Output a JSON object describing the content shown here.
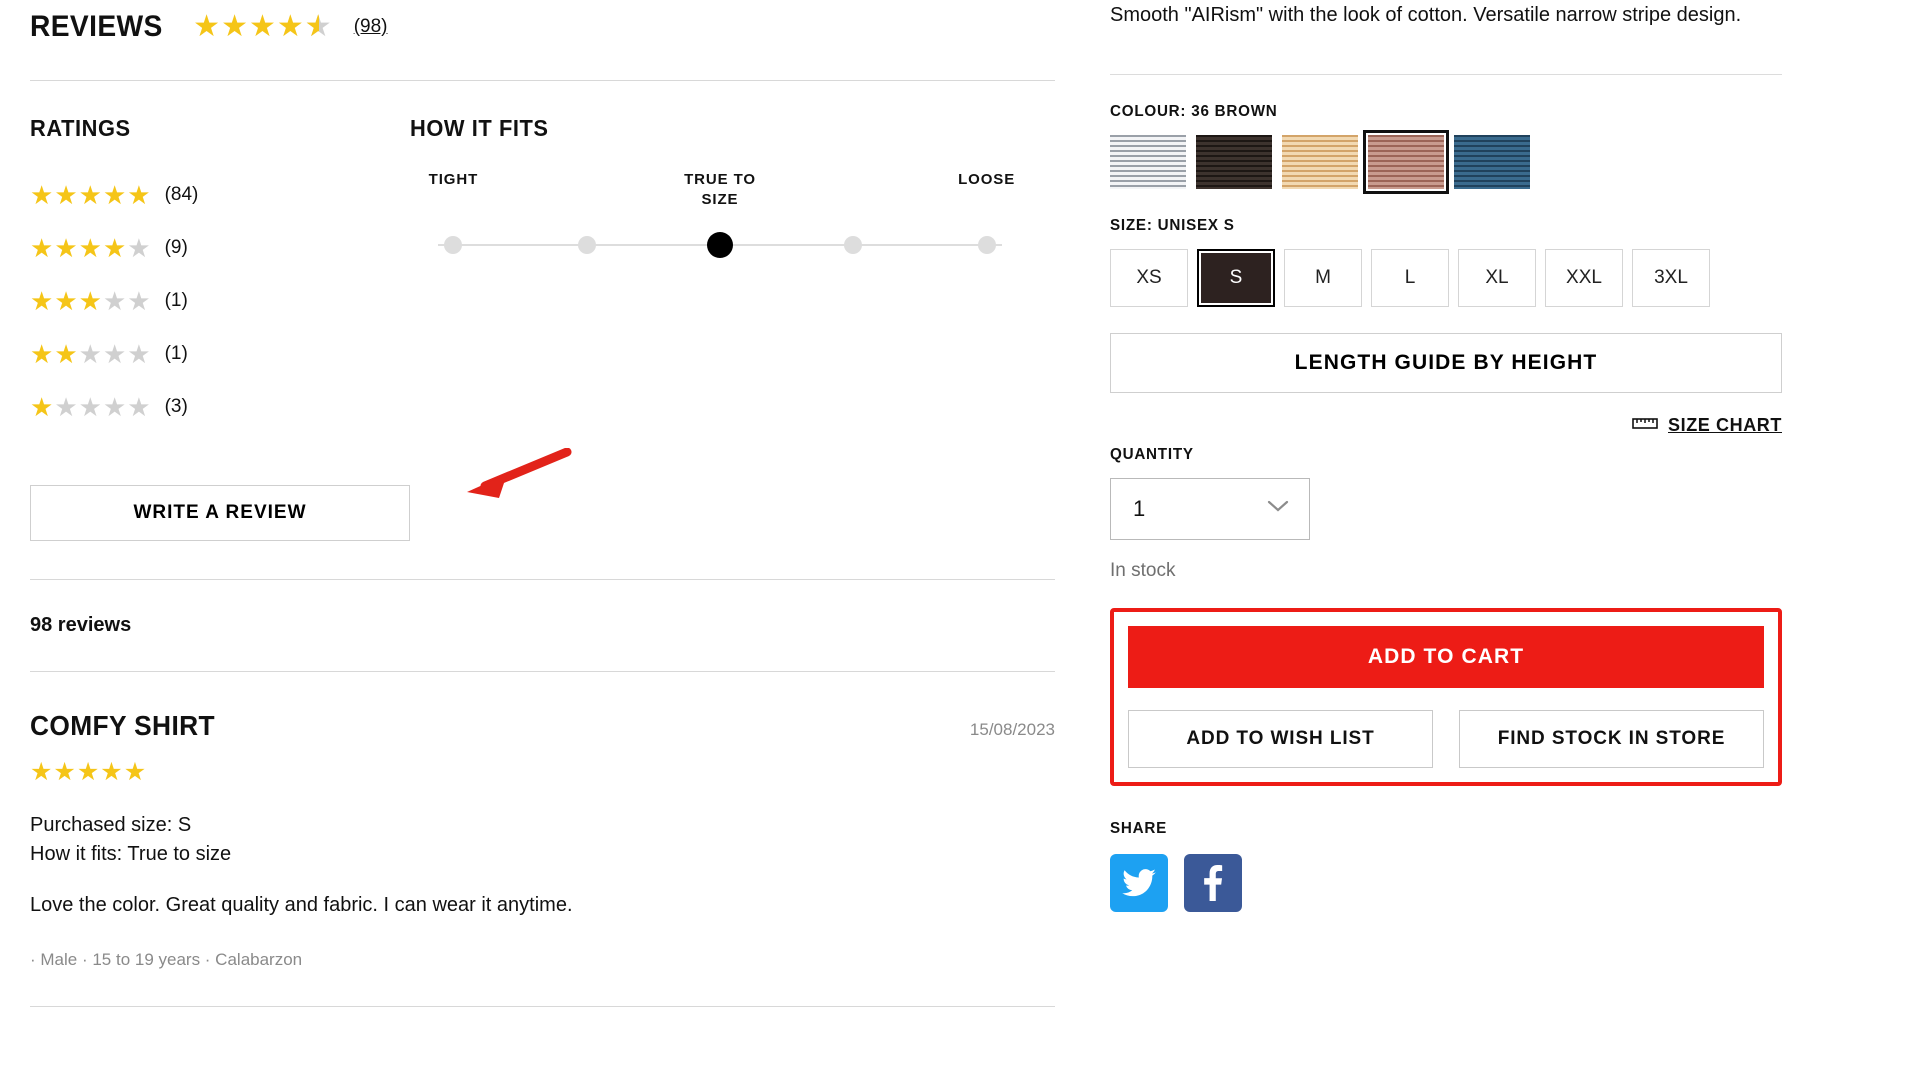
{
  "reviews_section": {
    "title": "REVIEWS",
    "average_rating": 4.5,
    "count_label": "(98)",
    "ratings": {
      "title": "RATINGS",
      "rows": [
        {
          "stars": 5,
          "count_label": "(84)"
        },
        {
          "stars": 4,
          "count_label": "(9)"
        },
        {
          "stars": 3,
          "count_label": "(1)"
        },
        {
          "stars": 2,
          "count_label": "(1)"
        },
        {
          "stars": 1,
          "count_label": "(3)"
        }
      ]
    },
    "how_it_fits": {
      "title": "HOW IT FITS",
      "labels": [
        {
          "text": "TIGHT",
          "position_pct": 7
        },
        {
          "text": "TRUE TO\nSIZE",
          "position_pct": 50
        },
        {
          "text": "LOOSE",
          "position_pct": 93
        }
      ],
      "dots": [
        {
          "position_pct": 7,
          "active": false
        },
        {
          "position_pct": 28.5,
          "active": false
        },
        {
          "position_pct": 50,
          "active": true
        },
        {
          "position_pct": 71.5,
          "active": false
        },
        {
          "position_pct": 93,
          "active": false
        }
      ]
    },
    "write_review_button": "WRITE A REVIEW",
    "total_reviews_label": "98 reviews",
    "review": {
      "title": "COMFY SHIRT",
      "date": "15/08/2023",
      "rating": 5,
      "purchased_size": "Purchased size: S",
      "how_it_fits": "How it fits: True to size",
      "body": "Love the color. Great quality and fabric. I can wear it anytime.",
      "author_meta": "· Male · 15 to 19 years · Calabarzon"
    }
  },
  "product": {
    "description_tail": "Smooth \"AIRism\" with the look of cotton. Versatile narrow stripe design.",
    "colour": {
      "label": "COLOUR: 36 BROWN",
      "swatches": [
        {
          "name": "white-stripe",
          "class": "sw-white",
          "selected": false
        },
        {
          "name": "black-stripe",
          "class": "sw-black",
          "selected": false
        },
        {
          "name": "beige-stripe",
          "class": "sw-beige",
          "selected": false
        },
        {
          "name": "brown-stripe",
          "class": "sw-brown",
          "selected": true
        },
        {
          "name": "navy-stripe",
          "class": "sw-navy",
          "selected": false
        }
      ]
    },
    "size": {
      "label": "SIZE: UNISEX S",
      "options": [
        {
          "label": "XS",
          "selected": false
        },
        {
          "label": "S",
          "selected": true
        },
        {
          "label": "M",
          "selected": false
        },
        {
          "label": "L",
          "selected": false
        },
        {
          "label": "XL",
          "selected": false
        },
        {
          "label": "XXL",
          "selected": false
        },
        {
          "label": "3XL",
          "selected": false
        }
      ]
    },
    "length_guide_button": "LENGTH GUIDE BY HEIGHT",
    "size_chart_link": "SIZE CHART",
    "quantity": {
      "label": "QUANTITY",
      "value": "1"
    },
    "stock_status": "In stock",
    "actions": {
      "add_to_cart": "ADD TO CART",
      "add_to_wish_list": "ADD TO WISH LIST",
      "find_stock_in_store": "FIND STOCK IN STORE"
    },
    "share": {
      "label": "SHARE",
      "networks": [
        {
          "name": "twitter",
          "glyph": "twitter-icon"
        },
        {
          "name": "facebook",
          "glyph": "facebook-icon"
        }
      ]
    }
  },
  "colors": {
    "accent_red": "#ED1C16",
    "star_gold": "#F5C518",
    "star_grey": "#d0d0d0",
    "selected_size_bg": "#2d2220",
    "twitter_blue": "#1DA1F2",
    "facebook_blue": "#3B5998"
  }
}
